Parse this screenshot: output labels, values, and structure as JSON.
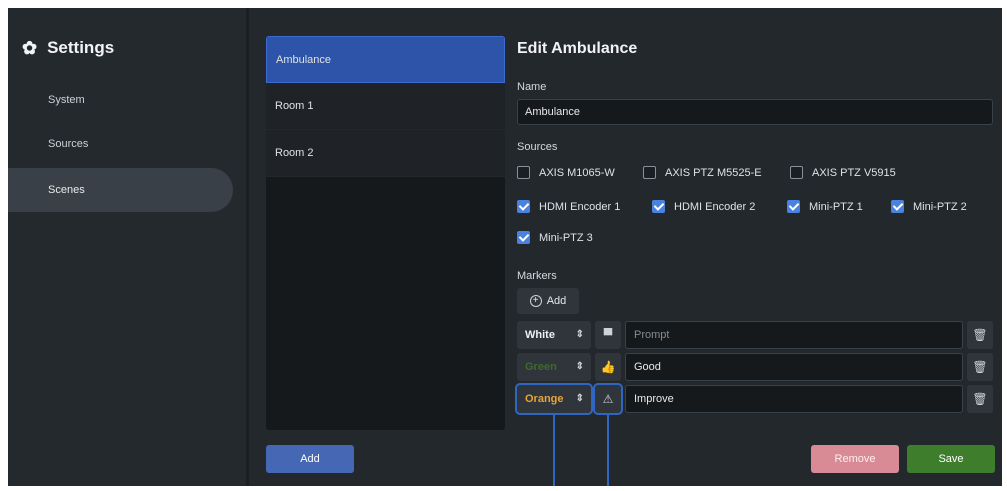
{
  "sidebar": {
    "title": "Settings",
    "title_icon": "gear-icon",
    "items": [
      {
        "label": "System"
      },
      {
        "label": "Sources"
      },
      {
        "label": "Scenes"
      }
    ]
  },
  "scenes": {
    "items": [
      {
        "label": "Ambulance"
      },
      {
        "label": "Room 1"
      },
      {
        "label": "Room 2"
      }
    ],
    "add_label": "Add"
  },
  "editor": {
    "title": "Edit Ambulance",
    "name_label": "Name",
    "name_value": "Ambulance",
    "sources_label": "Sources",
    "sources": [
      {
        "label": "AXIS M1065-W",
        "checked": false
      },
      {
        "label": "AXIS PTZ M5525-E",
        "checked": false
      },
      {
        "label": "AXIS PTZ V5915",
        "checked": false
      },
      {
        "label": "HDMI Encoder 1",
        "checked": true
      },
      {
        "label": "HDMI Encoder 2",
        "checked": true
      },
      {
        "label": "Mini-PTZ 1",
        "checked": true
      },
      {
        "label": "Mini-PTZ 2",
        "checked": true
      },
      {
        "label": "Mini-PTZ 3",
        "checked": true
      }
    ],
    "markers_label": "Markers",
    "add_marker_label": "Add",
    "markers": [
      {
        "color": "White",
        "color_hex": "#eef0f2",
        "icon": "comment-icon",
        "text": "",
        "placeholder": "Prompt"
      },
      {
        "color": "Green",
        "color_hex": "#3e6a2a",
        "icon": "thumbs-up-icon",
        "text": "Good",
        "placeholder": ""
      },
      {
        "color": "Orange",
        "color_hex": "#e8a33a",
        "icon": "warning-icon",
        "text": "Improve",
        "placeholder": ""
      }
    ],
    "remove_label": "Remove",
    "save_label": "Save"
  },
  "colors": {
    "accent": "#2d54a8",
    "checkbox": "#4a82e0",
    "remove": "#d98b95",
    "save": "#3e7d2c",
    "highlight": "#2f66c4"
  }
}
